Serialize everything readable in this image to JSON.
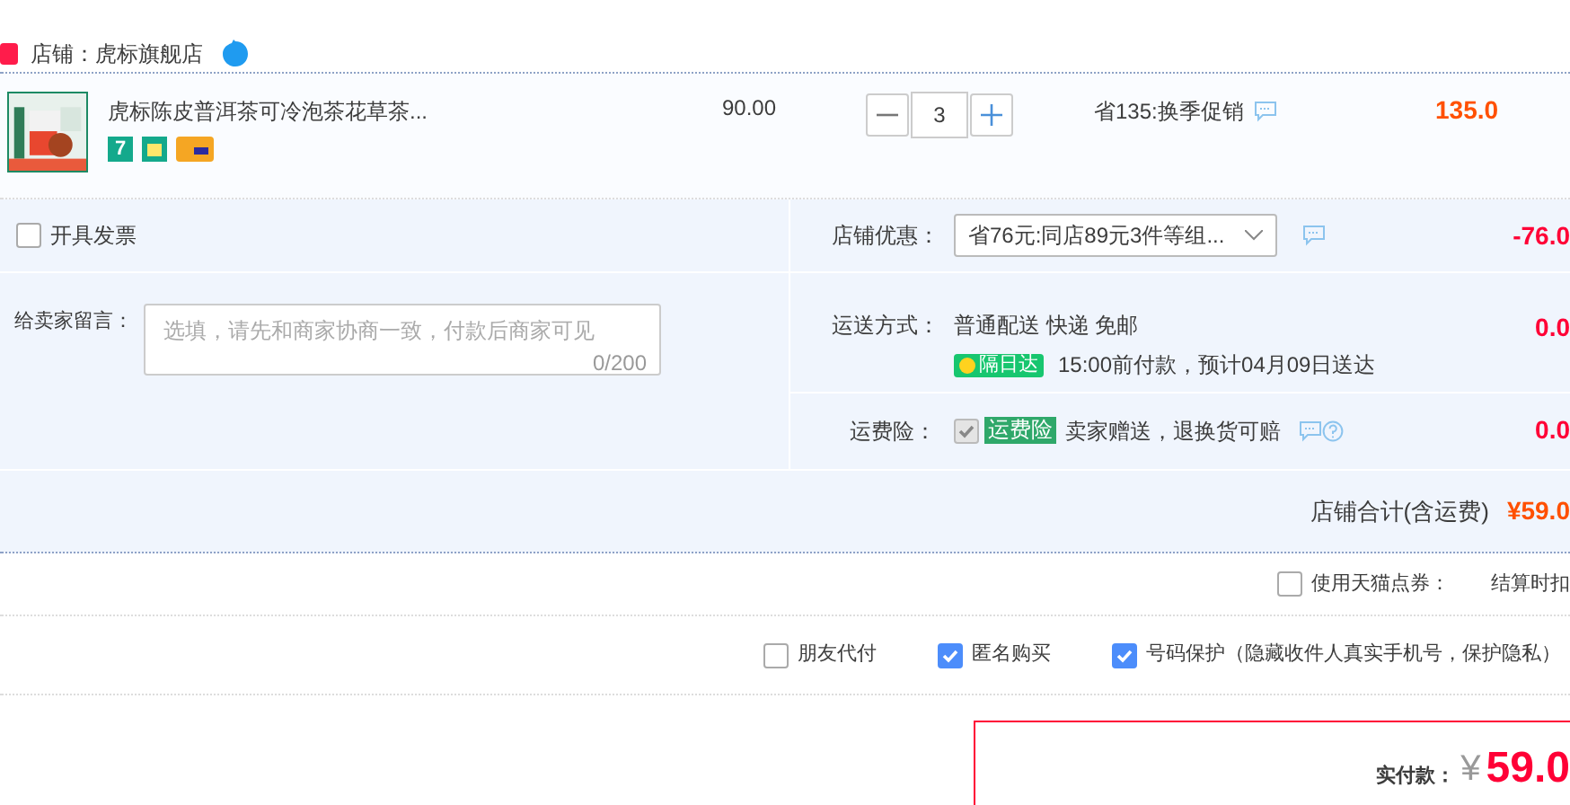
{
  "shop": {
    "label": "店铺：虎标旗舰店"
  },
  "item": {
    "title": "虎标陈皮普洱茶可冷泡茶花草茶...",
    "price": "90.00",
    "quantity": "3",
    "promo": "省135:换季促销",
    "subtotal": "135.0",
    "badge": "7"
  },
  "invoice": {
    "label": "开具发票",
    "checked": false
  },
  "message": {
    "label": "给卖家留言：",
    "placeholder": "选填，请先和商家协商一致，付款后商家可见",
    "counter": "0/200"
  },
  "coupon": {
    "label": "店铺优惠：",
    "value": "省76元:同店89元3件等组...",
    "amount": "-76.0"
  },
  "shipping": {
    "label": "运送方式：",
    "method": "普通配送 快递 免邮",
    "badge": "隔日达",
    "note": "15:00前付款，预计04月09日送达",
    "amount": "0.0"
  },
  "insurance": {
    "label": "运费险：",
    "checked": true,
    "disabled": true,
    "badge": "运费险",
    "note": "卖家赠送，退换货可赔",
    "amount": "0.0"
  },
  "total": {
    "label": "店铺合计(含运费)",
    "amount": "¥59.0"
  },
  "points": {
    "label": "使用天猫点券：",
    "checked": false,
    "note": "结算时扣"
  },
  "options": [
    {
      "label": "朋友代付",
      "checked": false
    },
    {
      "label": "匿名购买",
      "checked": true
    },
    {
      "label": "号码保护（隐藏收件人真实手机号，保护隐私）",
      "checked": true
    }
  ],
  "payment": {
    "label": "实付款：",
    "currency": "¥",
    "amount": "59.0"
  }
}
